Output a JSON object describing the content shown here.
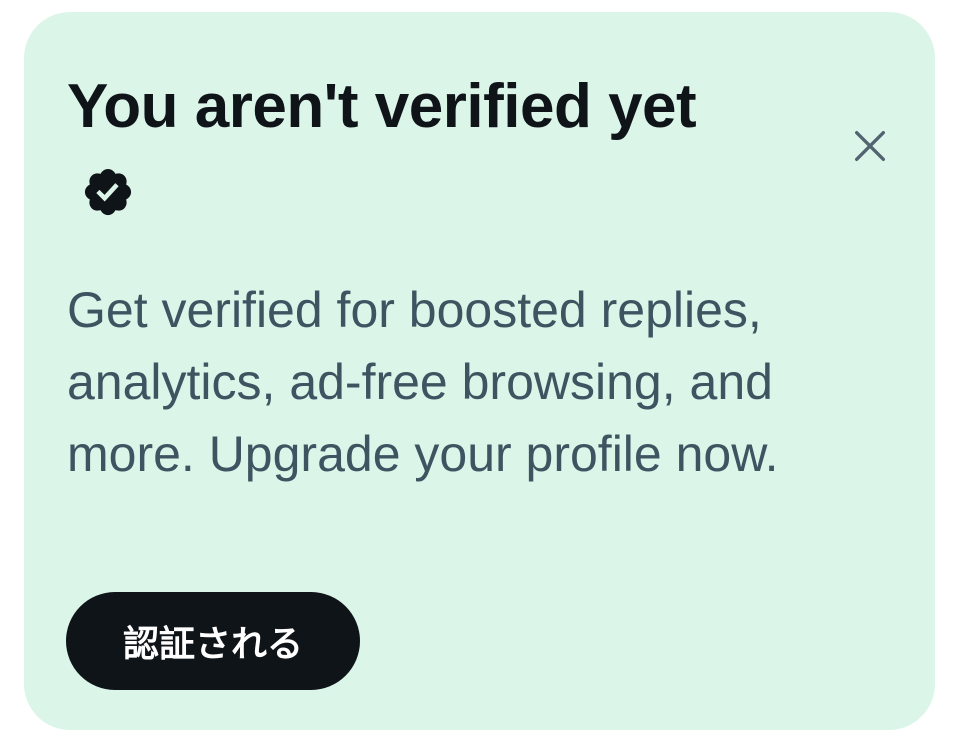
{
  "card": {
    "title": "You aren't verified yet",
    "badge_icon": "verified-badge-icon",
    "close_icon": "close-icon",
    "description": "Get verified for boosted replies, analytics, ad-free browsing, and more. Upgrade your profile now.",
    "cta_label": "認証される"
  },
  "colors": {
    "card_background": "#dcf5e9",
    "title_text": "#0f1419",
    "body_text": "#3e5461",
    "button_background": "#0f1419",
    "button_text": "#ffffff",
    "close_icon": "#536471"
  }
}
